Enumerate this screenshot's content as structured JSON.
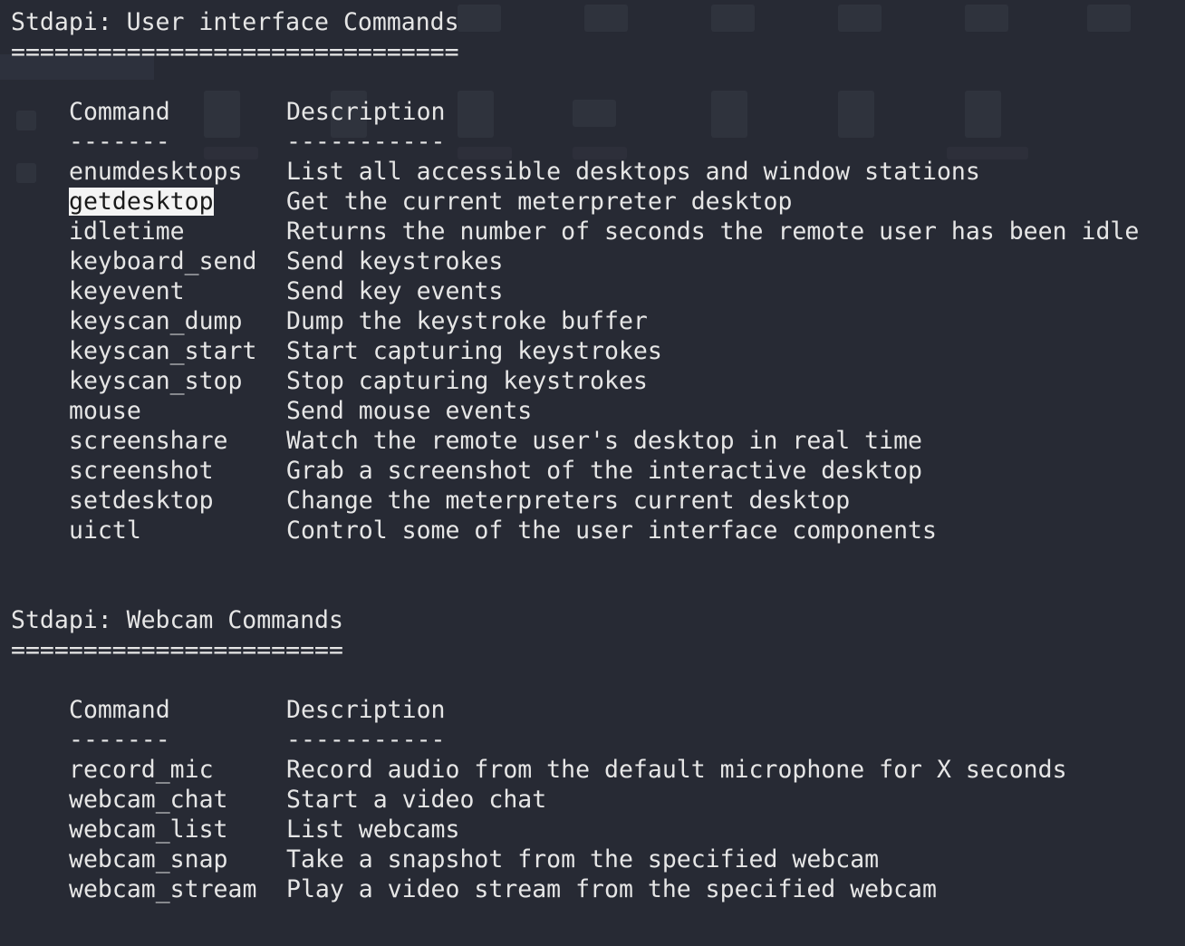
{
  "section_ui": {
    "title": "Stdapi: User interface Commands",
    "underline": "===============================",
    "header_cmd": "Command",
    "header_desc": "Description",
    "sep_cmd": "-------",
    "sep_desc": "-----------",
    "rows": [
      {
        "cmd": "enumdesktops",
        "desc": "List all accessible desktops and window stations"
      },
      {
        "cmd": "getdesktop",
        "desc": "Get the current meterpreter desktop"
      },
      {
        "cmd": "idletime",
        "desc": "Returns the number of seconds the remote user has been idle"
      },
      {
        "cmd": "keyboard_send",
        "desc": "Send keystrokes"
      },
      {
        "cmd": "keyevent",
        "desc": "Send key events"
      },
      {
        "cmd": "keyscan_dump",
        "desc": "Dump the keystroke buffer"
      },
      {
        "cmd": "keyscan_start",
        "desc": "Start capturing keystrokes"
      },
      {
        "cmd": "keyscan_stop",
        "desc": "Stop capturing keystrokes"
      },
      {
        "cmd": "mouse",
        "desc": "Send mouse events"
      },
      {
        "cmd": "screenshare",
        "desc": "Watch the remote user's desktop in real time"
      },
      {
        "cmd": "screenshot",
        "desc": "Grab a screenshot of the interactive desktop"
      },
      {
        "cmd": "setdesktop",
        "desc": "Change the meterpreters current desktop"
      },
      {
        "cmd": "uictl",
        "desc": "Control some of the user interface components"
      }
    ]
  },
  "section_webcam": {
    "title": "Stdapi: Webcam Commands",
    "underline": "=======================",
    "header_cmd": "Command",
    "header_desc": "Description",
    "sep_cmd": "-------",
    "sep_desc": "-----------",
    "rows": [
      {
        "cmd": "record_mic",
        "desc": "Record audio from the default microphone for X seconds"
      },
      {
        "cmd": "webcam_chat",
        "desc": "Start a video chat"
      },
      {
        "cmd": "webcam_list",
        "desc": "List webcams"
      },
      {
        "cmd": "webcam_snap",
        "desc": "Take a snapshot from the specified webcam"
      },
      {
        "cmd": "webcam_stream",
        "desc": "Play a video stream from the specified webcam"
      }
    ]
  },
  "colors": {
    "background": "#272a34",
    "text": "#e6e6e6",
    "highlight_bg": "#f4f4f4",
    "highlight_fg": "#1a1a1a"
  }
}
